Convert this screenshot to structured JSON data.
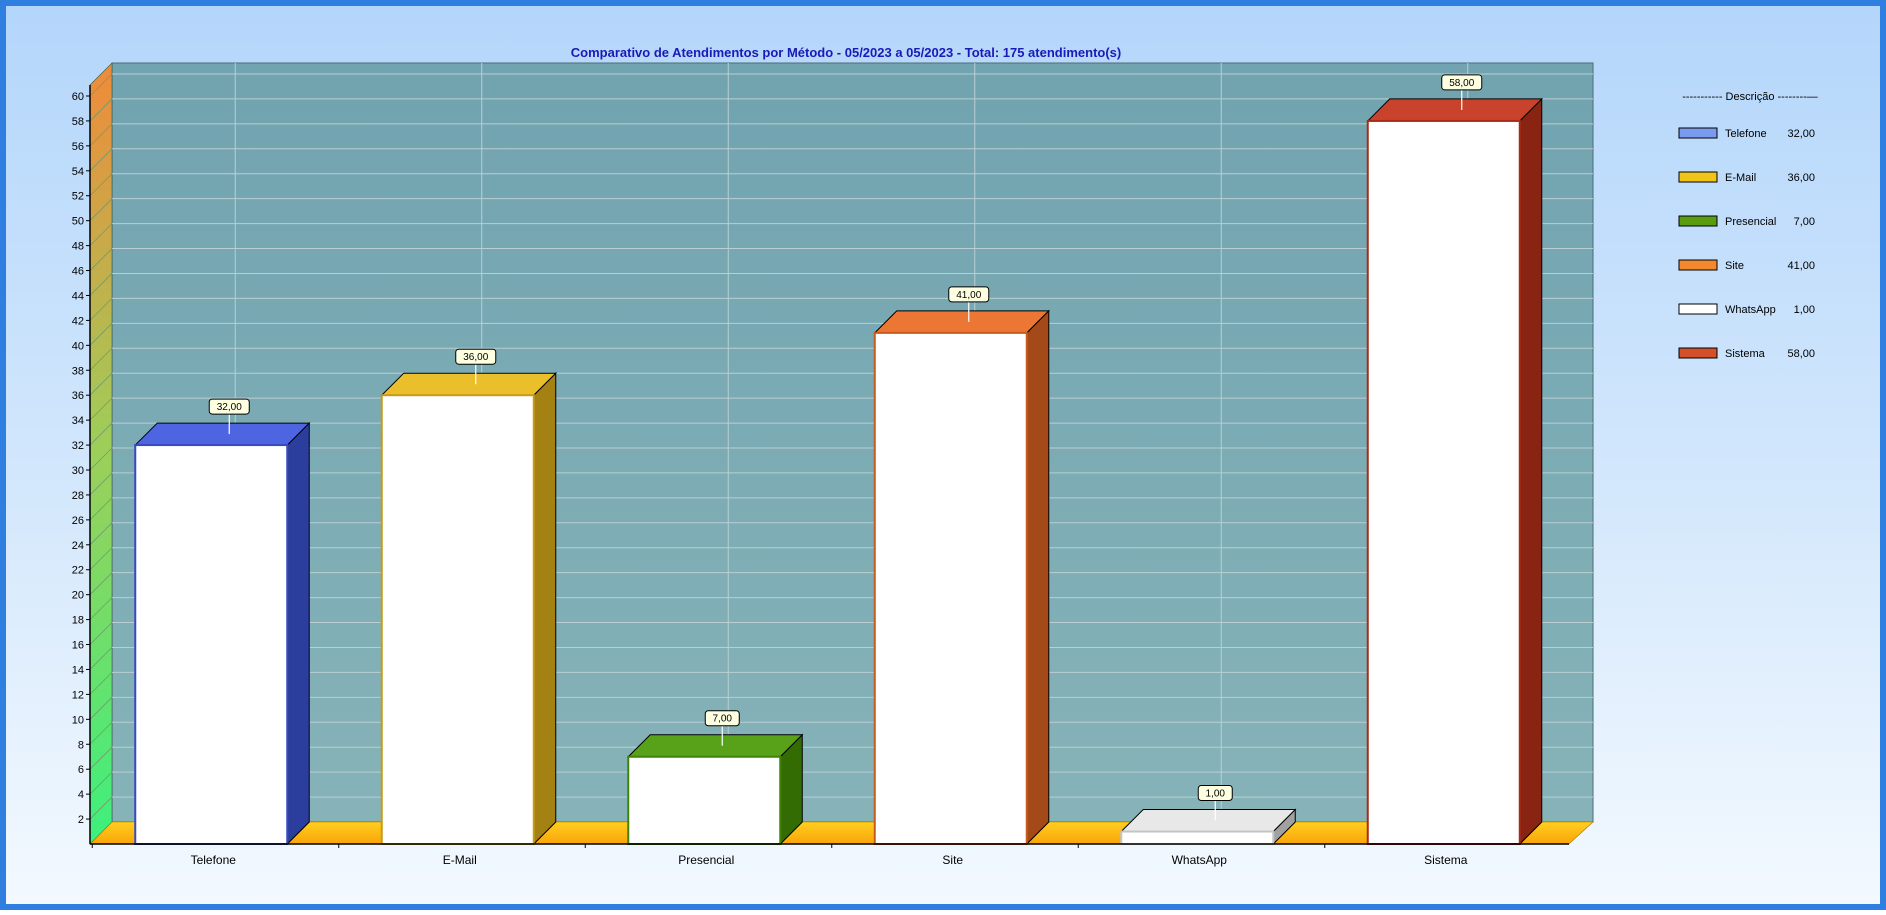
{
  "chart_data": {
    "type": "bar",
    "title": "Comparativo de Atendimentos por Método - 05/2023 a 05/2023 - Total: 175 atendimento(s)",
    "categories": [
      "Telefone",
      "E-Mail",
      "Presencial",
      "Site",
      "WhatsApp",
      "Sistema"
    ],
    "values": [
      32,
      36,
      7,
      41,
      1,
      58
    ],
    "value_labels": [
      "32,00",
      "36,00",
      "7,00",
      "41,00",
      "1,00",
      "58,00"
    ],
    "colors": [
      "#3f58e0",
      "#e9b81a",
      "#4a9a06",
      "#ea6a22",
      "#e6e6e6",
      "#c4331a"
    ],
    "ylim": [
      0,
      60
    ],
    "yticks": [
      "2",
      "4",
      "6",
      "8",
      "10",
      "12",
      "14",
      "16",
      "18",
      "20",
      "22",
      "24",
      "26",
      "28",
      "30",
      "32",
      "34",
      "36",
      "38",
      "40",
      "42",
      "44",
      "46",
      "48",
      "50",
      "52",
      "54",
      "56",
      "58",
      "60"
    ],
    "grid": true,
    "three_d": true,
    "legend_position": "right",
    "legend": {
      "header": "----------- Descrição --------—",
      "items": [
        {
          "label": "Telefone",
          "value": "32,00",
          "color": "#7b9bef"
        },
        {
          "label": "E-Mail",
          "value": "36,00",
          "color": "#f1c418"
        },
        {
          "label": "Presencial",
          "value": "7,00",
          "color": "#5a9c10"
        },
        {
          "label": "Site",
          "value": "41,00",
          "color": "#f3892e"
        },
        {
          "label": "WhatsApp",
          "value": "1,00",
          "color": "#ffffff"
        },
        {
          "label": "Sistema",
          "value": "58,00",
          "color": "#d2502a"
        }
      ]
    }
  }
}
